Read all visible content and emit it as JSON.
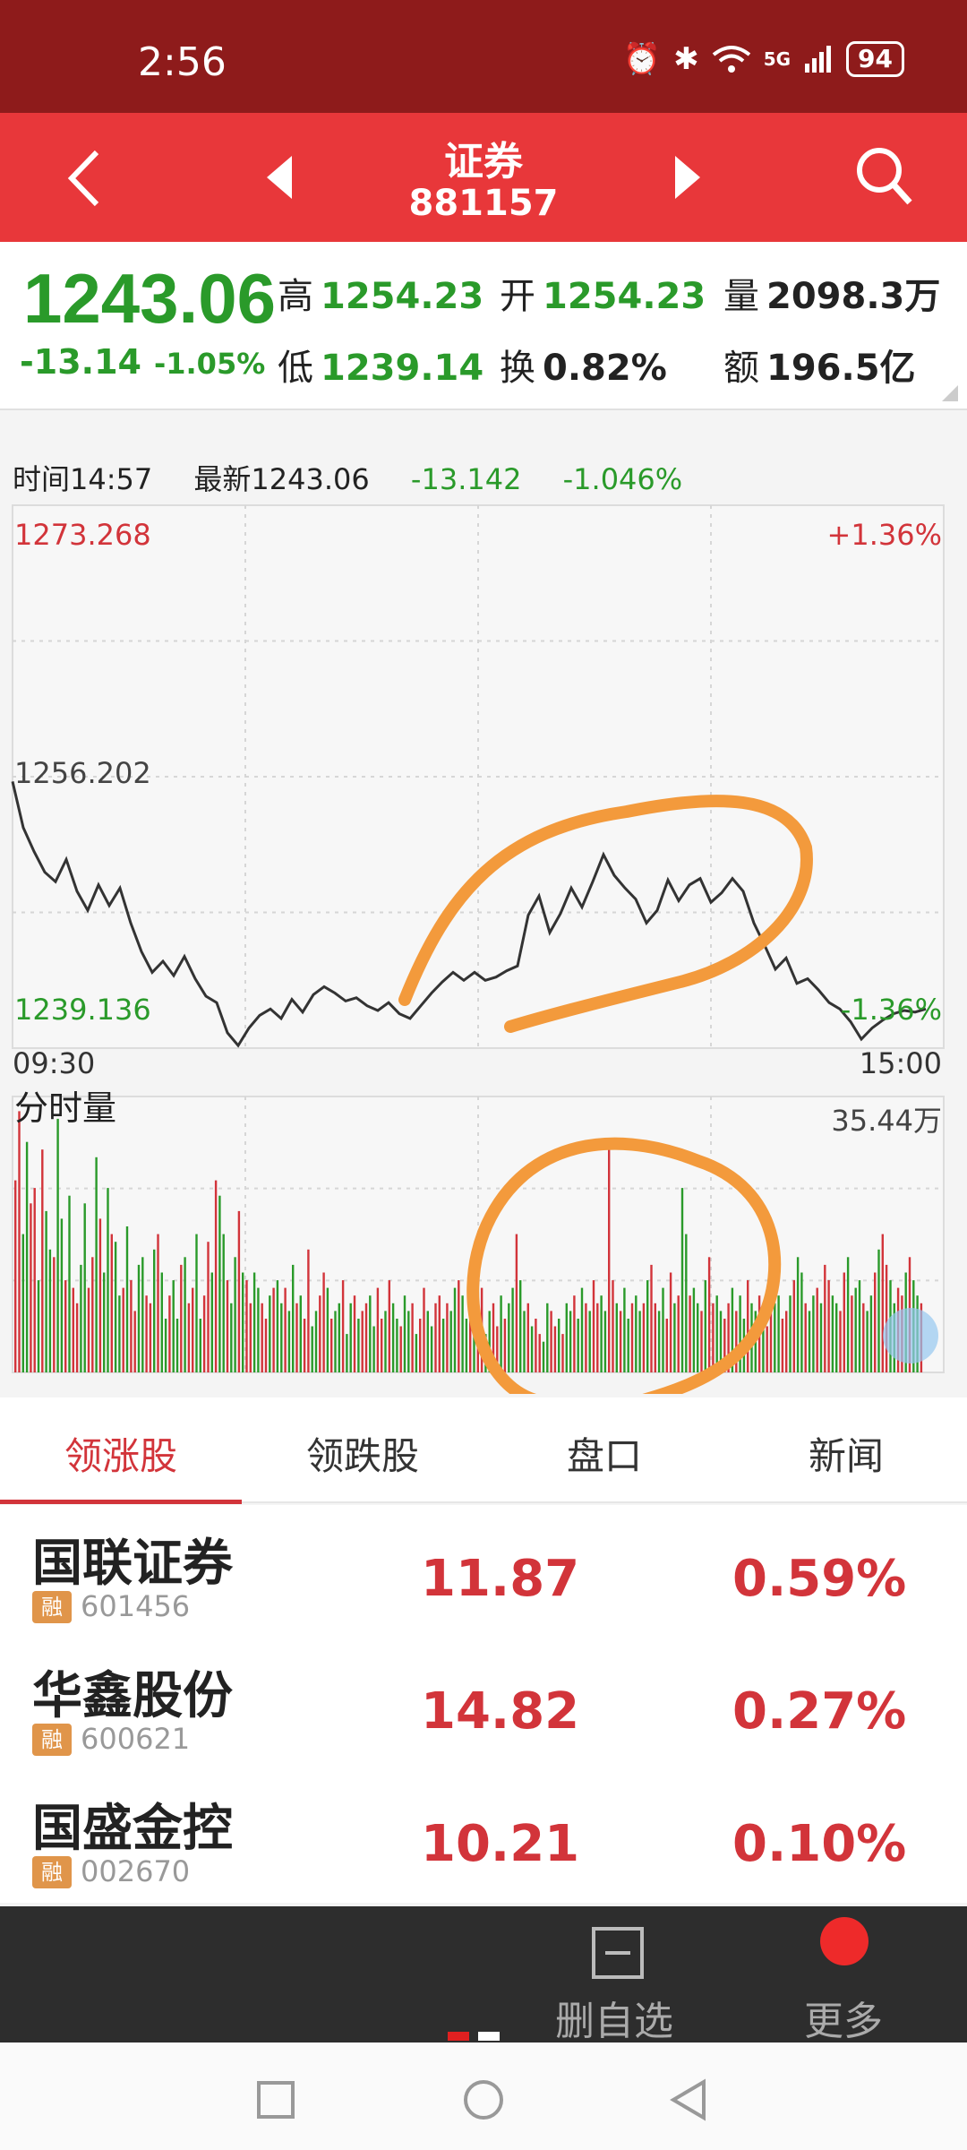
{
  "status": {
    "time": "2:56",
    "network": "5G",
    "battery": "94"
  },
  "title": {
    "name": "证券",
    "code": "881157"
  },
  "quote": {
    "price": "1243.06",
    "change": "-13.14",
    "change_pct": "-1.05%",
    "cells": [
      {
        "label": "高",
        "value": "1254.23",
        "color": "green"
      },
      {
        "label": "开",
        "value": "1254.23",
        "color": "green"
      },
      {
        "label": "量",
        "value": "2098.3万",
        "color": "dark"
      },
      {
        "label": "低",
        "value": "1239.14",
        "color": "green"
      },
      {
        "label": "换",
        "value": "0.82%",
        "color": "dark"
      },
      {
        "label": "额",
        "value": "196.5亿",
        "color": "dark"
      }
    ]
  },
  "info": {
    "time": "时间14:57",
    "latest": "最新1243.06",
    "delta": "-13.142",
    "delta_pct": "-1.046%"
  },
  "chart_data": [
    {
      "type": "line",
      "title": "",
      "xlabel": "",
      "ylabel": "",
      "x_ticks": [
        "09:30",
        "15:00"
      ],
      "y_ticks": [
        "1273.268",
        "1256.202",
        "1239.136"
      ],
      "right_ticks": [
        "+1.36%",
        "-1.36%"
      ],
      "ylim": [
        1239.136,
        1273.268
      ],
      "series": [
        {
          "values": [
            1255.9,
            1253.0,
            1251.5,
            1250.2,
            1249.6,
            1251.0,
            1249.0,
            1247.8,
            1249.4,
            1248.1,
            1249.2,
            1247.0,
            1245.2,
            1243.9,
            1244.6,
            1243.7,
            1244.9,
            1243.5,
            1242.4,
            1242.0,
            1240.1,
            1239.3,
            1240.4,
            1241.2,
            1241.6,
            1241.0,
            1242.2,
            1241.4,
            1242.5,
            1243.0,
            1242.6,
            1242.1,
            1242.3,
            1241.8,
            1241.5,
            1242.0,
            1241.3,
            1241.0,
            1241.8,
            1242.6,
            1243.3,
            1243.9,
            1243.4,
            1243.9,
            1243.4,
            1243.6,
            1244.0,
            1244.3,
            1247.5,
            1248.7,
            1246.4,
            1247.6,
            1249.2,
            1248.0,
            1249.6,
            1251.3,
            1250.0,
            1249.2,
            1248.5,
            1247.0,
            1247.8,
            1249.7,
            1248.4,
            1249.4,
            1249.8,
            1248.3,
            1248.9,
            1249.8,
            1249.0,
            1247.0,
            1245.6,
            1244.1,
            1244.8,
            1243.2,
            1243.5,
            1242.8,
            1242.0,
            1241.6,
            1240.8,
            1239.7,
            1240.4,
            1240.9,
            1241.3,
            1241.5,
            1241.4,
            1241.6
          ]
        }
      ]
    },
    {
      "type": "bar",
      "title": "分时量",
      "xlabel": "",
      "ylabel": "",
      "y_max_label": "35.44万",
      "ylim": [
        0,
        35.44
      ],
      "series": [
        {
          "values": [
            25,
            34,
            18,
            30,
            22,
            24,
            12,
            29,
            21,
            16,
            15,
            33,
            20,
            12,
            23,
            11,
            9,
            14,
            22,
            11,
            15,
            28,
            20,
            13,
            24,
            18,
            17,
            10,
            11,
            19,
            12,
            8,
            14,
            15,
            10,
            9,
            16,
            18,
            13,
            7,
            10,
            12,
            7,
            14,
            15,
            9,
            11,
            18,
            7,
            10,
            17,
            13,
            25,
            23,
            18,
            12,
            9,
            15,
            21,
            13,
            12,
            9,
            13,
            11,
            9,
            7,
            10,
            11,
            12,
            9,
            11,
            8,
            14,
            9,
            10,
            7,
            16,
            6,
            8,
            10,
            13,
            11,
            7,
            8,
            9,
            12,
            5,
            9,
            10,
            7,
            8,
            9,
            10,
            6,
            11,
            7,
            8,
            12,
            9,
            7,
            6,
            10,
            8,
            9,
            5,
            7,
            11,
            8,
            6,
            9,
            10,
            7,
            9,
            8,
            11,
            12,
            10,
            7,
            8,
            9,
            10,
            11,
            5,
            8,
            9,
            6,
            10,
            7,
            9,
            11,
            18,
            12,
            8,
            9,
            6,
            7,
            5,
            4,
            9,
            8,
            6,
            7,
            5,
            9,
            8,
            10,
            7,
            11,
            9,
            8,
            12,
            9,
            10,
            8,
            30,
            12,
            9,
            8,
            11,
            7,
            9,
            10,
            8,
            9,
            12,
            14,
            9,
            8,
            11,
            7,
            13,
            9,
            10,
            24,
            18,
            10,
            11,
            9,
            8,
            12,
            15,
            9,
            10,
            8,
            7,
            9,
            11,
            8,
            10,
            7,
            12,
            9,
            8,
            10,
            7,
            6,
            8,
            9,
            10,
            7,
            8,
            10,
            12,
            15,
            13,
            9,
            8,
            10,
            11,
            9,
            14,
            12,
            10,
            9,
            8,
            13,
            15,
            10,
            11,
            12,
            9,
            8,
            10,
            13,
            16,
            18,
            14,
            12,
            9,
            11,
            10,
            13,
            15,
            12,
            10,
            9
          ]
        }
      ]
    }
  ],
  "tabs": [
    "领涨股",
    "领跌股",
    "盘口",
    "新闻"
  ],
  "stocks": [
    {
      "name": "国联证券",
      "tag": "融",
      "code": "601456",
      "price": "11.87",
      "pct": "0.59%"
    },
    {
      "name": "华鑫股份",
      "tag": "融",
      "code": "600621",
      "price": "14.82",
      "pct": "0.27%"
    },
    {
      "name": "国盛金控",
      "tag": "融",
      "code": "002670",
      "price": "10.21",
      "pct": "0.10%"
    }
  ],
  "toolbar": {
    "remove_label": "删自选",
    "more_label": "更多"
  },
  "colors": {
    "up": "#d2343a",
    "down": "#2a9a2a",
    "header": "#e8373a",
    "annotation": "#f39a3c"
  }
}
